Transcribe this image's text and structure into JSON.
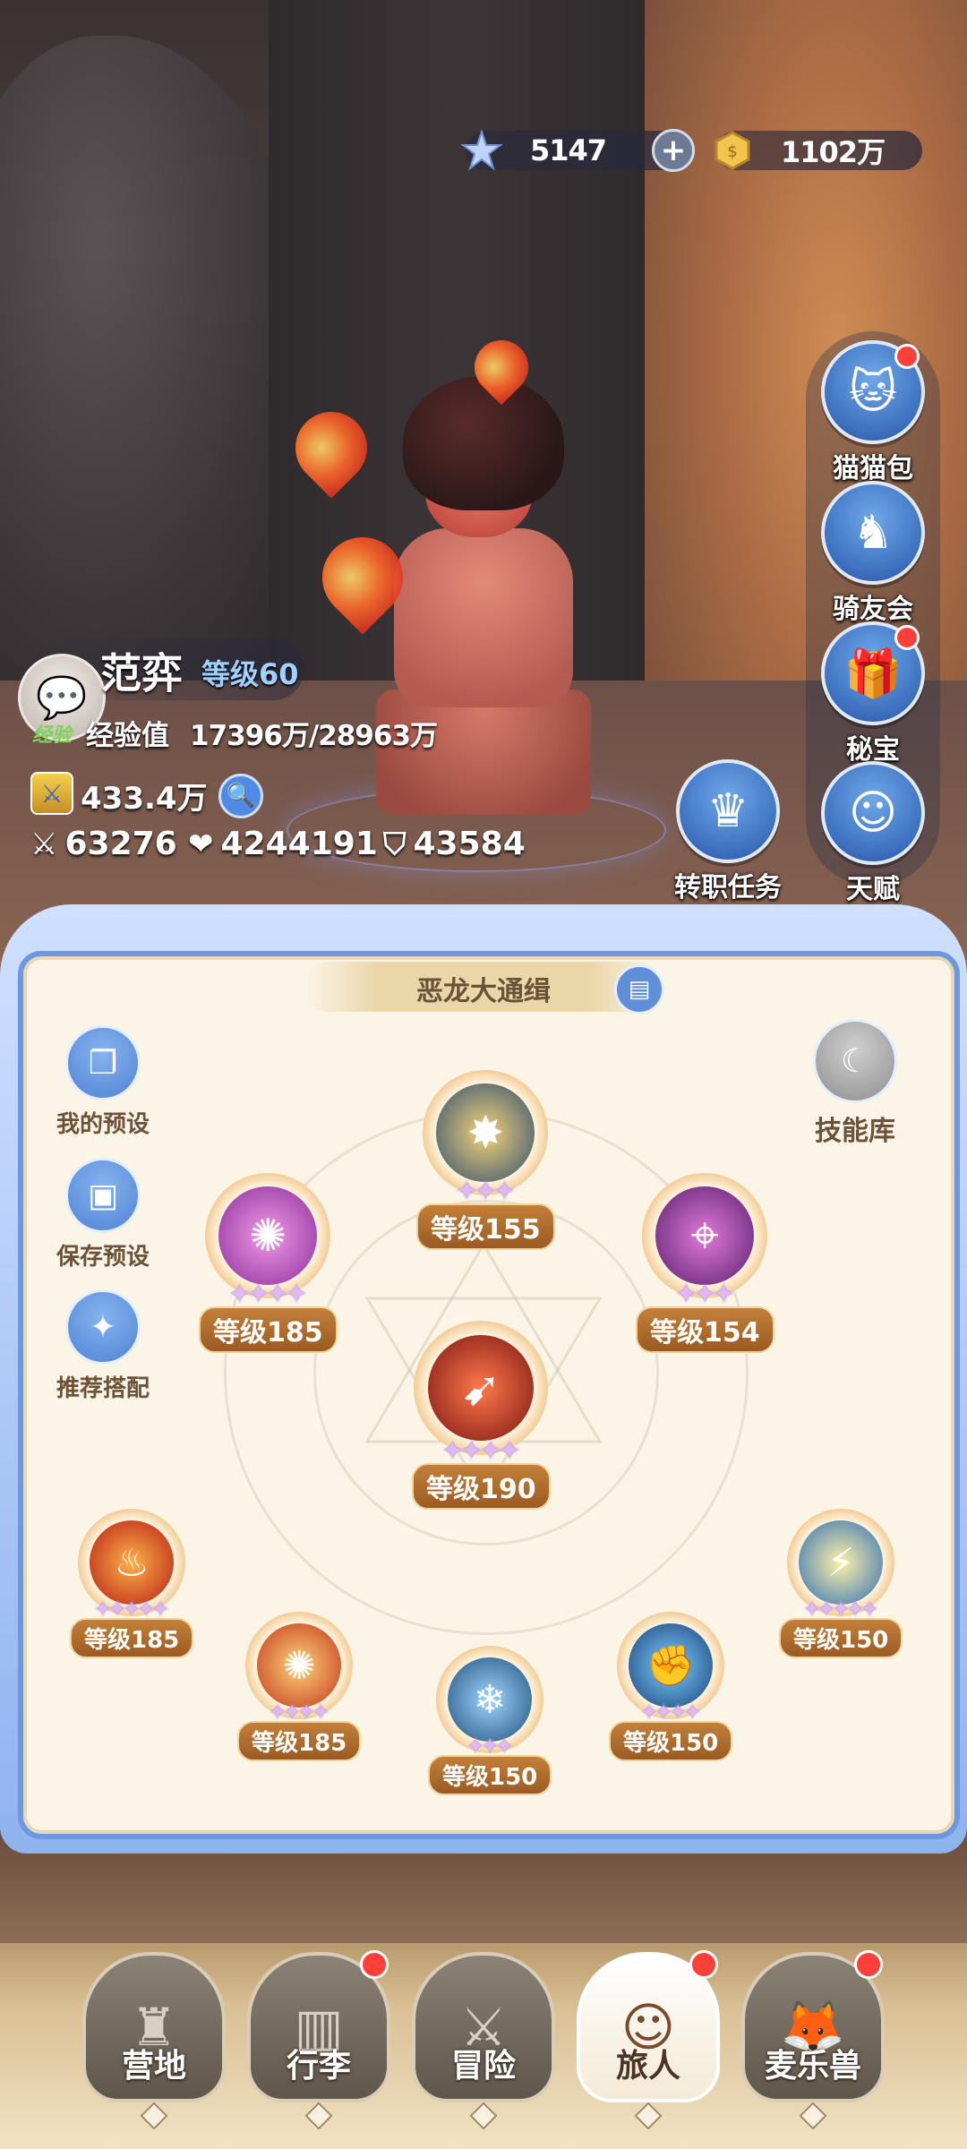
{
  "currency": {
    "gems": "5147",
    "coins": "1102万",
    "gem_icon": "crystal-star-icon",
    "coin_icon": "gold-coin-icon"
  },
  "side_menu": [
    {
      "label": "猫猫包",
      "icon": "cat-bag-icon",
      "badge": true
    },
    {
      "label": "骑友会",
      "icon": "horse-icon",
      "badge": false
    },
    {
      "label": "秘宝",
      "icon": "treasure-icon",
      "badge": true
    },
    {
      "label": "天赋",
      "icon": "brain-icon",
      "badge": false
    }
  ],
  "player": {
    "name": "范弈",
    "level": "等级60",
    "exp_tag": "经验",
    "exp_label": "经验值",
    "exp_value": "17396万/28963万",
    "power": "433.4万",
    "attack": "63276",
    "hp": "4244191",
    "defense": "43584"
  },
  "job_quest": {
    "label": "转职任务"
  },
  "panel": {
    "title": "恶龙大通缉",
    "left_actions": [
      {
        "label": "我的预设"
      },
      {
        "label": "保存预设"
      },
      {
        "label": "推荐搭配"
      }
    ],
    "skill_library": "技能库",
    "skills": [
      {
        "level": "等级155",
        "stars": 3
      },
      {
        "level": "等级185",
        "stars": 4
      },
      {
        "level": "等级154",
        "stars": 3
      },
      {
        "level": "等级190",
        "stars": 4
      },
      {
        "level": "等级185",
        "stars": 5
      },
      {
        "level": "等级185",
        "stars": 4
      },
      {
        "level": "等级150",
        "stars": 3
      },
      {
        "level": "等级150",
        "stars": 4
      },
      {
        "level": "等级150",
        "stars": 5
      }
    ]
  },
  "bottom_nav": [
    {
      "label": "营地",
      "badge": false,
      "active": false
    },
    {
      "label": "行李",
      "badge": true,
      "active": false
    },
    {
      "label": "冒险",
      "badge": false,
      "active": false
    },
    {
      "label": "旅人",
      "badge": true,
      "active": true
    },
    {
      "label": "麦乐兽",
      "badge": true,
      "active": false
    }
  ],
  "colors": {
    "accent_blue": "#5f8fd9",
    "panel_bg": "#fbf5e8",
    "level_badge": "#b06b2c",
    "badge_red": "#ff3f3a"
  }
}
